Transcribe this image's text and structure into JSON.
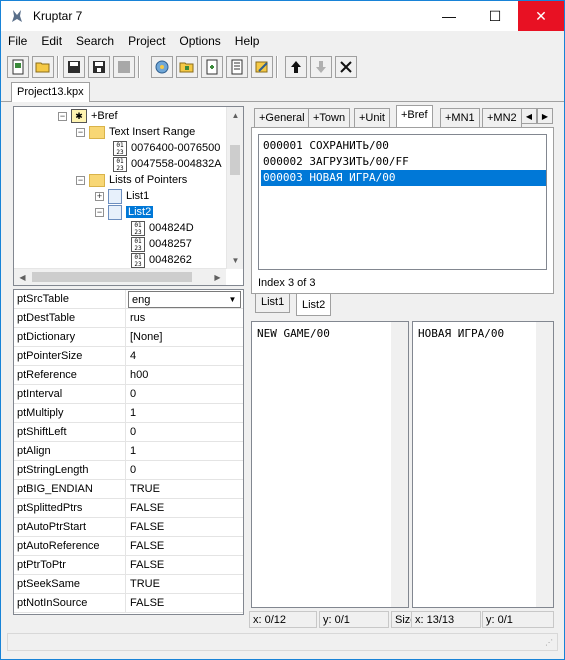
{
  "window": {
    "title": "Kruptar 7",
    "minimize_glyph": "—",
    "maximize_glyph": "☐",
    "close_glyph": "✕"
  },
  "menu": [
    "File",
    "Edit",
    "Search",
    "Project",
    "Options",
    "Help"
  ],
  "toolbar": {
    "icons": [
      "new-project-icon",
      "open-icon",
      "save-icon",
      "save-all-icon",
      "close-project-icon",
      "add-group-icon",
      "add-folder-icon",
      "add-file-icon",
      "add-list-icon",
      "edit-icon",
      "move-up-icon",
      "move-down-icon",
      "delete-icon"
    ]
  },
  "project_tab": "Project13.kpx",
  "tree": {
    "items": [
      {
        "label": "+Bref",
        "level": 0,
        "icon": "star-folder-icon",
        "expander": "−"
      },
      {
        "label": "Text Insert Range",
        "level": 1,
        "icon": "folder-icon",
        "expander": "−"
      },
      {
        "label": "0076400-0076500",
        "level": 2,
        "icon": "hex-icon",
        "expander": ""
      },
      {
        "label": "0047558-004832A",
        "level": 2,
        "icon": "hex-icon",
        "expander": ""
      },
      {
        "label": "Lists of Pointers",
        "level": 1,
        "icon": "folder-icon",
        "expander": "−"
      },
      {
        "label": "List1",
        "level": 2,
        "icon": "doc-icon",
        "expander": "+"
      },
      {
        "label": "List2",
        "level": 2,
        "icon": "doc-icon",
        "expander": "−",
        "selected": true
      },
      {
        "label": "004824D",
        "level": 3,
        "icon": "hex-icon",
        "expander": ""
      },
      {
        "label": "0048257",
        "level": 3,
        "icon": "hex-icon",
        "expander": ""
      },
      {
        "label": "0048262",
        "level": 3,
        "icon": "hex-icon",
        "expander": ""
      }
    ]
  },
  "properties": [
    {
      "name": "ptSrcTable",
      "value": "eng",
      "combo": true
    },
    {
      "name": "ptDestTable",
      "value": "rus"
    },
    {
      "name": "ptDictionary",
      "value": "[None]"
    },
    {
      "name": "ptPointerSize",
      "value": "4"
    },
    {
      "name": "ptReference",
      "value": "h00"
    },
    {
      "name": "ptInterval",
      "value": "0"
    },
    {
      "name": "ptMultiply",
      "value": "1"
    },
    {
      "name": "ptShiftLeft",
      "value": "0"
    },
    {
      "name": "ptAlign",
      "value": "1"
    },
    {
      "name": "ptStringLength",
      "value": "0"
    },
    {
      "name": "ptBIG_ENDIAN",
      "value": "TRUE"
    },
    {
      "name": "ptSplittedPtrs",
      "value": "FALSE"
    },
    {
      "name": "ptAutoPtrStart",
      "value": "FALSE"
    },
    {
      "name": "ptAutoReference",
      "value": "FALSE"
    },
    {
      "name": "ptPtrToPtr",
      "value": "FALSE"
    },
    {
      "name": "ptSeekSame",
      "value": "TRUE"
    },
    {
      "name": "ptNotInSource",
      "value": "FALSE"
    }
  ],
  "group_tabs": [
    {
      "label": "+General"
    },
    {
      "label": "+Town"
    },
    {
      "label": "+Unit"
    },
    {
      "label": "+Bref",
      "active": true
    },
    {
      "label": "+MN1"
    },
    {
      "label": "+MN2"
    }
  ],
  "strings": [
    {
      "text": "000001 СОХРАНИТЬ/00"
    },
    {
      "text": "000002 ЗАГРУЗИТЬ/00/FF"
    },
    {
      "text": "000003 НОВАЯ ИГРА/00",
      "selected": true
    }
  ],
  "index_label": "Index 3 of 3",
  "list_tabs": [
    {
      "label": "List1"
    },
    {
      "label": "List2",
      "active": true
    }
  ],
  "original_text": "NEW GAME/00",
  "translated_text": "НОВАЯ ИГРА/00",
  "status": {
    "left_x": "x: 0/12",
    "left_y": "y: 0/1",
    "size": "Size",
    "right_x": "x: 13/13",
    "right_y": "y: 0/1"
  }
}
